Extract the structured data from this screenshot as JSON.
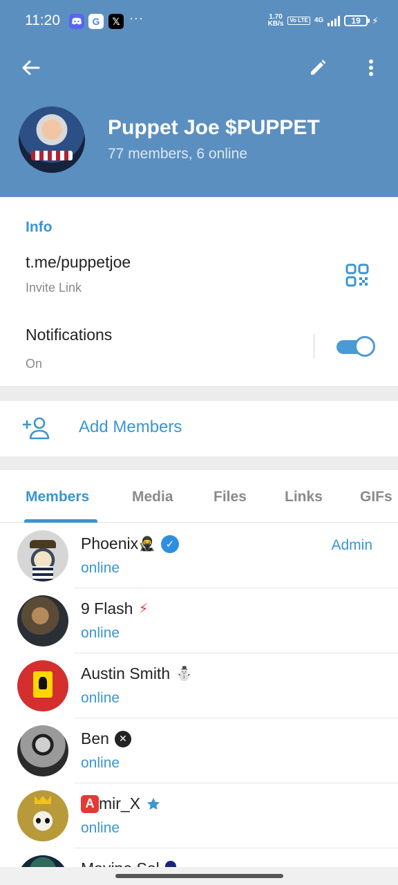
{
  "status_bar": {
    "time": "11:20",
    "notif_icons": [
      "discord-icon",
      "google-icon",
      "x-icon"
    ],
    "overflow": "···",
    "net_speed_value": "1.70",
    "net_speed_unit": "KB/s",
    "volte": "Vo LTE",
    "network": "4G",
    "battery": "19"
  },
  "header": {
    "title": "Puppet Joe $PUPPET",
    "subtitle": "77 members, 6 online",
    "colors": {
      "background": "#5b8fc0"
    }
  },
  "info": {
    "heading": "Info",
    "link": "t.me/puppetjoe",
    "link_label": "Invite Link",
    "notifications_label": "Notifications",
    "notifications_state": "On",
    "notifications_on": true
  },
  "add_members": {
    "label": "Add Members"
  },
  "tabs": [
    {
      "label": "Members",
      "active": true
    },
    {
      "label": "Media",
      "active": false
    },
    {
      "label": "Files",
      "active": false
    },
    {
      "label": "Links",
      "active": false
    },
    {
      "label": "GIFs",
      "active": false
    }
  ],
  "members": [
    {
      "name": "Phoenix",
      "emoji": "🥷",
      "badge": "verified-icon",
      "status": "online",
      "role": "Admin"
    },
    {
      "name": "9 Flash",
      "emoji": "⚡",
      "badge": "",
      "status": "online",
      "role": ""
    },
    {
      "name": "Austin Smith",
      "emoji": "⛄",
      "badge": "",
      "status": "online",
      "role": ""
    },
    {
      "name": "Ben",
      "emoji": "",
      "badge": "x-circle-icon",
      "status": "online",
      "role": ""
    },
    {
      "name": "mir_X",
      "prefix": "A",
      "emoji": "",
      "badge": "star-icon",
      "status": "online",
      "role": ""
    },
    {
      "name": "Mavine Sol",
      "emoji": "",
      "badge": "",
      "status": "",
      "role": ""
    }
  ],
  "colors": {
    "accent": "#3a95d0",
    "toggle": "#4a9ad6"
  }
}
